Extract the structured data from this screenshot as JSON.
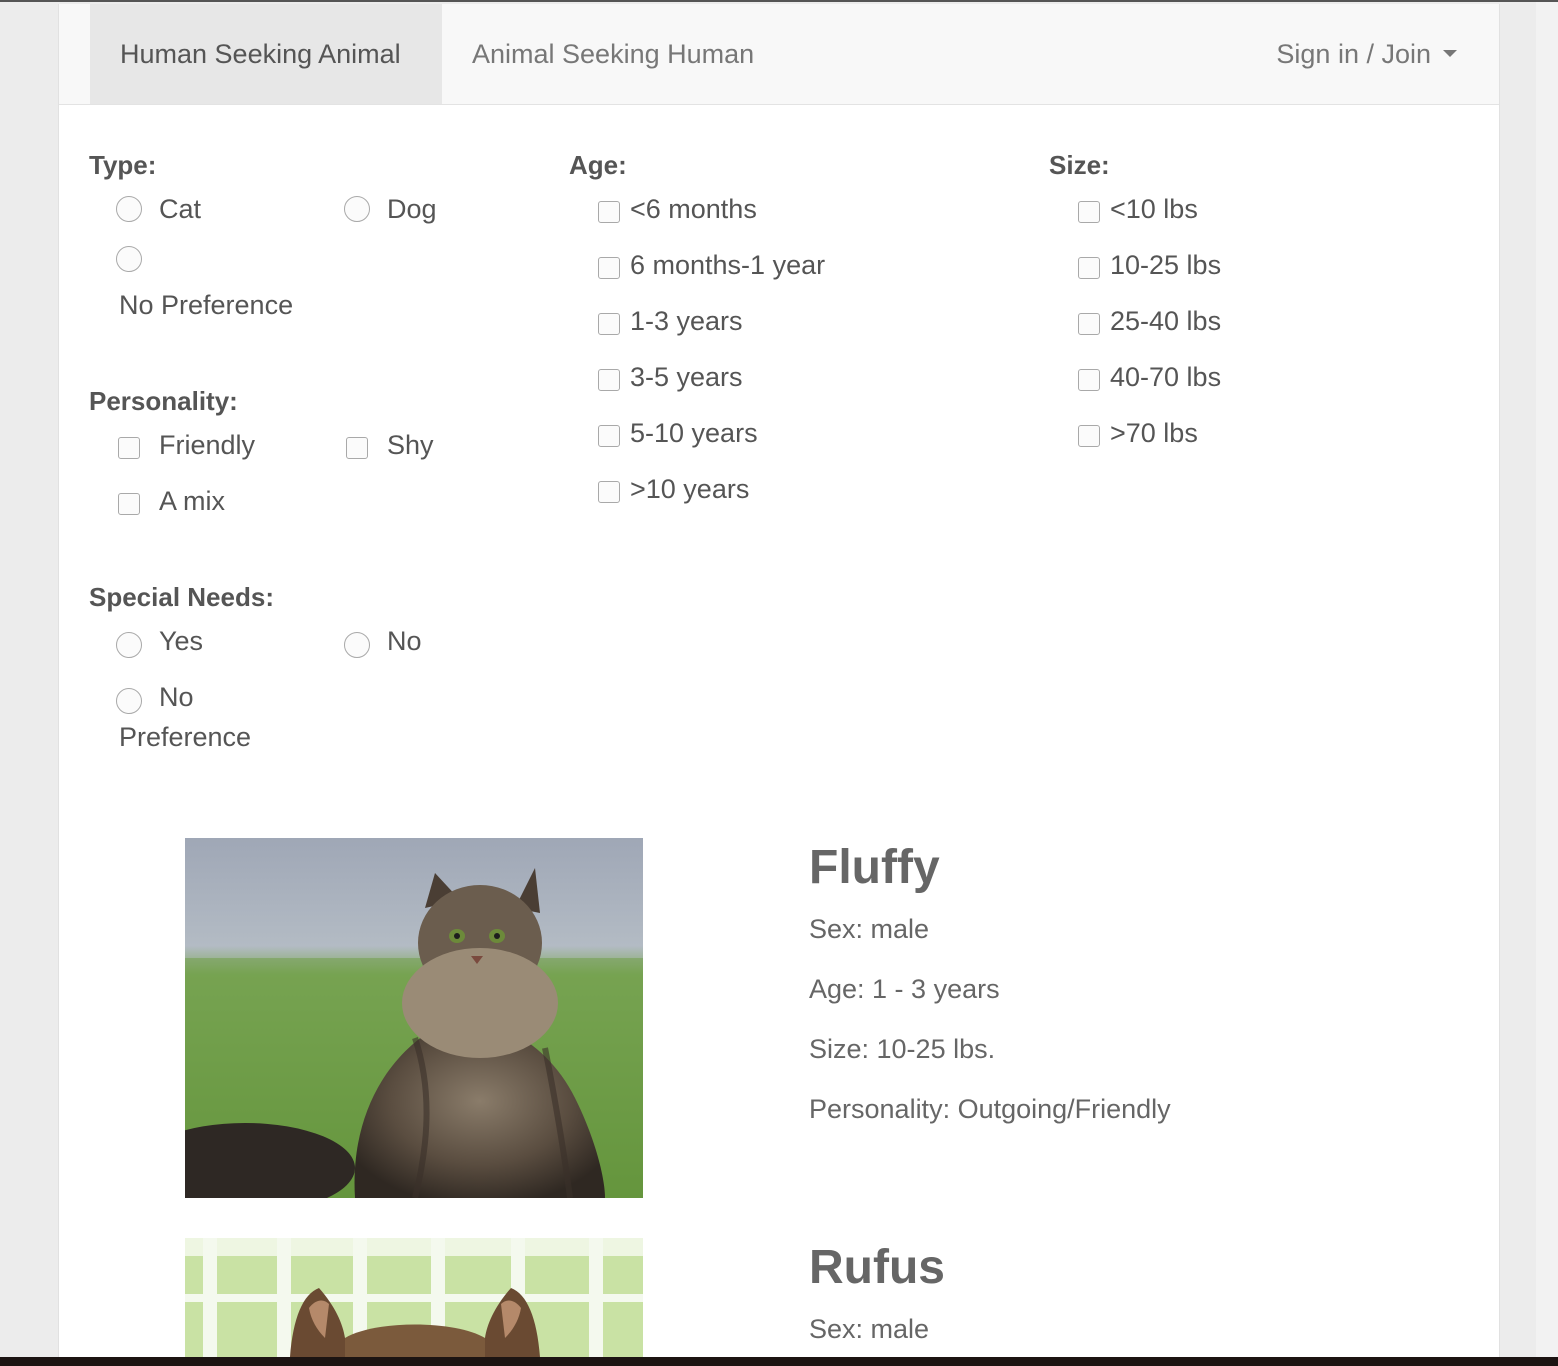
{
  "nav": {
    "tabs": [
      "Human Seeking Animal",
      "Animal Seeking Human"
    ],
    "account": "Sign in / Join"
  },
  "filters": {
    "type": {
      "label": "Type:",
      "options": [
        "Cat",
        "Dog",
        "No Preference"
      ]
    },
    "personality": {
      "label": "Personality:",
      "options": [
        "Friendly",
        "Shy",
        "A mix"
      ]
    },
    "special_needs": {
      "label": "Special Needs:",
      "options": [
        "Yes",
        "No",
        "No",
        "Preference"
      ]
    },
    "age": {
      "label": "Age:",
      "options": [
        "<6 months",
        "6 months-1 year",
        "1-3 years",
        "3-5 years",
        "5-10 years",
        ">10 years"
      ]
    },
    "size": {
      "label": "Size:",
      "options": [
        "<10 lbs",
        "10-25 lbs",
        "25-40 lbs",
        "40-70 lbs",
        ">70 lbs"
      ]
    }
  },
  "pets": [
    {
      "name": "Fluffy",
      "sex": "Sex: male",
      "age": "Age: 1 - 3 years",
      "size": "Size: 10-25 lbs.",
      "personality": "Personality: Outgoing/Friendly"
    },
    {
      "name": "Rufus",
      "sex": "Sex: male"
    }
  ]
}
